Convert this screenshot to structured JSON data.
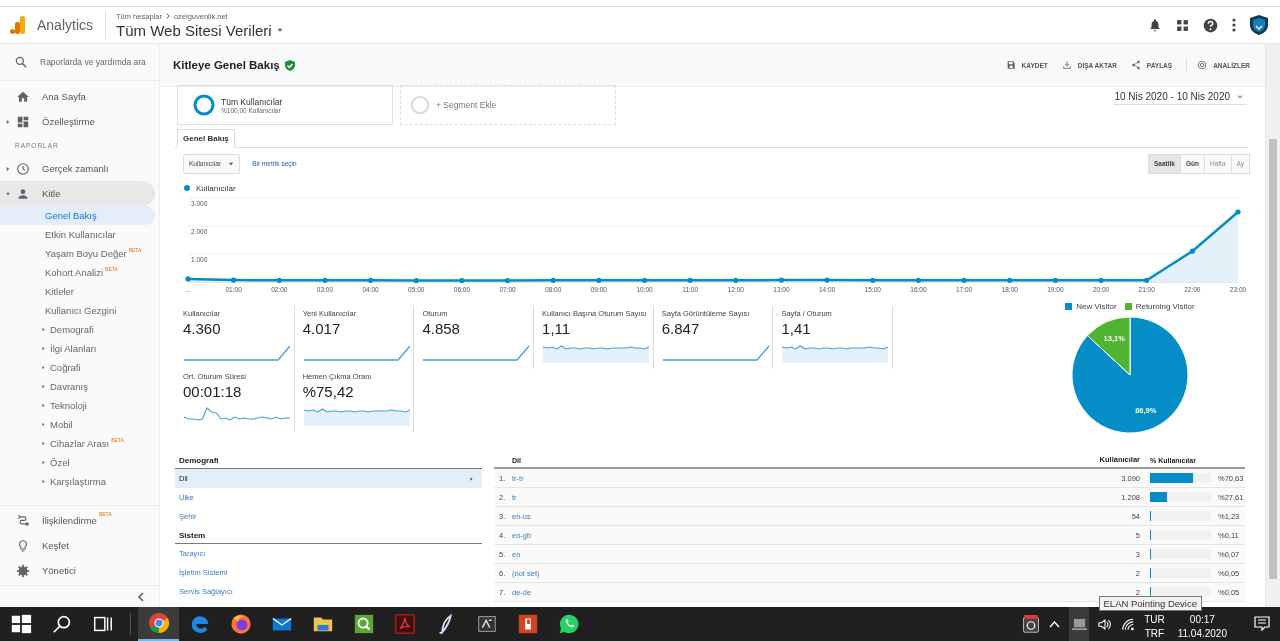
{
  "header": {
    "product": "Analytics",
    "breadcrumb": [
      "Tüm hesaplar",
      "ozelguvenlik.net"
    ],
    "property": "Tüm Web Sitesi Verileri"
  },
  "sidebar": {
    "search_placeholder": "Raporlarda ve yardımda ara",
    "nav": [
      {
        "label": "Ana Sayfa",
        "kind": "home",
        "selected": false
      },
      {
        "label": "Özelleştirme",
        "kind": "dashboard",
        "selected": false,
        "expanded": false
      }
    ],
    "reports_heading": "RAPORLAR",
    "reports": [
      {
        "label": "Gerçek zamanlı",
        "kind": "clock",
        "selected": false,
        "expanded": false
      },
      {
        "label": "Kitle",
        "kind": "person",
        "selected": true,
        "expanded": true,
        "children": [
          {
            "label": "Genel Bakış",
            "selected": true
          },
          {
            "label": "Etkin Kullanıcılar",
            "selected": false
          },
          {
            "label": "Yaşam Boyu Değer",
            "selected": false,
            "badge": "BETA"
          },
          {
            "label": "Kohort Analizi",
            "selected": false,
            "badge": "BETA"
          },
          {
            "label": "Kitleler",
            "selected": false
          },
          {
            "label": "Kullanıcı Gezgini",
            "selected": false
          },
          {
            "label": "Demografi",
            "selected": false,
            "expanded": false
          },
          {
            "label": "İlgi Alanları",
            "selected": false,
            "expanded": false
          },
          {
            "label": "Coğrafi",
            "selected": false,
            "expanded": false
          },
          {
            "label": "Davranış",
            "selected": false,
            "expanded": false
          },
          {
            "label": "Teknoloji",
            "selected": false,
            "expanded": false
          },
          {
            "label": "Mobil",
            "selected": false,
            "expanded": false
          },
          {
            "label": "Cihazlar Arası",
            "selected": false,
            "expanded": false,
            "badge": "BETA"
          },
          {
            "label": "Özel",
            "selected": false,
            "expanded": false
          },
          {
            "label": "Karşılaştırma",
            "selected": false,
            "expanded": false
          }
        ]
      }
    ],
    "bottom": [
      {
        "label": "İlişkilendirme",
        "kind": "attribution",
        "badge": "BETA"
      },
      {
        "label": "Keşfet",
        "kind": "discover"
      },
      {
        "label": "Yönetici",
        "kind": "admin"
      }
    ]
  },
  "report": {
    "title": "Kitleye Genel Bakış",
    "actions": [
      {
        "label": "KAYDET",
        "kind": "save"
      },
      {
        "label": "DIŞA AKTAR",
        "kind": "export"
      },
      {
        "label": "PAYLAŞ",
        "kind": "share"
      },
      {
        "label": "ANALİZLER",
        "kind": "insights"
      }
    ],
    "segments": [
      {
        "kind": "segment",
        "title": "Tüm Kullanıcılar",
        "subtitle": "%100,00 Kullanıcılar"
      },
      {
        "kind": "add",
        "title": "+ Segment Ekle"
      }
    ],
    "date_range": "10 Nis 2020 - 10 Nis 2020",
    "tabs": [
      {
        "label": "Genel Bakış",
        "selected": true
      }
    ],
    "metric_select": {
      "value": "Kullanıcılar",
      "link": "Bir metrik seçin"
    },
    "granularity": [
      {
        "label": "Saatlik",
        "selected": true,
        "disabled": false
      },
      {
        "label": "Gün",
        "selected": false,
        "disabled": false
      },
      {
        "label": "Hafta",
        "selected": false,
        "disabled": true
      },
      {
        "label": "Ay",
        "selected": false,
        "disabled": true
      }
    ],
    "chart_data": {
      "type": "area",
      "categories": [
        "...",
        "01:00",
        "02:00",
        "03:00",
        "04:00",
        "05:00",
        "06:00",
        "07:00",
        "08:00",
        "09:00",
        "10:00",
        "11:00",
        "12:00",
        "13:00",
        "14:00",
        "15:00",
        "16:00",
        "17:00",
        "18:00",
        "19:00",
        "20:00",
        "21:00",
        "22:00",
        "23:00"
      ],
      "series": [
        {
          "name": "Kullanıcılar",
          "color": "#058dc7",
          "values": [
            110,
            70,
            60,
            60,
            60,
            50,
            50,
            50,
            60,
            60,
            60,
            60,
            60,
            70,
            70,
            60,
            60,
            60,
            60,
            60,
            60,
            60,
            1100,
            2500
          ]
        }
      ],
      "ylim": [
        0,
        3000
      ],
      "yticks": [
        {
          "value": 1000,
          "label": "1.000"
        },
        {
          "value": 2000,
          "label": "2.000"
        },
        {
          "value": 3000,
          "label": "3.000"
        }
      ]
    },
    "metrics": [
      {
        "label": "Kullanıcılar",
        "value": "4.360",
        "kind": "rising"
      },
      {
        "label": "Yeni Kullanıcılar",
        "value": "4.017",
        "kind": "rising"
      },
      {
        "label": "Oturum",
        "value": "4.858",
        "kind": "rising"
      },
      {
        "label": "Kullanıcı Başına Oturum Sayısı",
        "value": "1,11",
        "kind": "steady"
      },
      {
        "label": "Sayfa Görüntüleme Sayısı",
        "value": "6.847",
        "kind": "rising"
      },
      {
        "label": "Sayfa / Oturum",
        "value": "1,41",
        "kind": "steady"
      },
      {
        "label": "Ort. Oturum Süresi",
        "value": "00:01:18",
        "kind": "spiky"
      },
      {
        "label": "Hemen Çıkma Oranı",
        "value": "%75,42",
        "kind": "steady"
      }
    ],
    "visitor_chart": {
      "chart_data": {
        "type": "pie",
        "categories": [
          "New Visitor",
          "Returning Visitor"
        ],
        "values": [
          86.9,
          13.1
        ],
        "value_labels": [
          "86,9%",
          "13,1%"
        ]
      }
    },
    "explorer": [
      {
        "title": "Demografi",
        "items": [
          {
            "label": "Dil",
            "selected": true
          },
          {
            "label": "Ülke",
            "selected": false
          },
          {
            "label": "Şehir",
            "selected": false
          }
        ]
      },
      {
        "title": "Sistem",
        "items": [
          {
            "label": "Tarayıcı",
            "selected": false
          },
          {
            "label": "İşletim Sistemi",
            "selected": false
          },
          {
            "label": "Servis Sağlayıcı",
            "selected": false
          }
        ]
      }
    ],
    "table": {
      "columns": [
        "Dil",
        "Kullanıcılar",
        "% Kullanıcılar"
      ],
      "rows": [
        {
          "rank": "1.",
          "name": "tr-tr",
          "users": "3.090",
          "share": "%70,63",
          "level": 0.7063
        },
        {
          "rank": "2.",
          "name": "tr",
          "users": "1.208",
          "share": "%27,61",
          "level": 0.2761
        },
        {
          "rank": "3.",
          "name": "en-us",
          "users": "54",
          "share": "%1,23",
          "level": 0.0123
        },
        {
          "rank": "4.",
          "name": "en-gb",
          "users": "5",
          "share": "%0,11",
          "level": 0.0011
        },
        {
          "rank": "5.",
          "name": "en",
          "users": "3",
          "share": "%0,07",
          "level": 0.0007
        },
        {
          "rank": "6.",
          "name": "(not set)",
          "users": "2",
          "share": "%0,05",
          "level": 0.0005
        },
        {
          "rank": "7.",
          "name": "de-de",
          "users": "2",
          "share": "%0,05",
          "level": 0.0005
        }
      ]
    }
  },
  "taskbar": {
    "items": [
      {
        "kind": "start",
        "selected": false
      },
      {
        "kind": "search",
        "selected": false
      },
      {
        "kind": "taskview",
        "selected": false
      },
      {
        "kind": "chrome",
        "selected": true
      },
      {
        "kind": "edge",
        "selected": false
      },
      {
        "kind": "firefox",
        "selected": false
      },
      {
        "kind": "mail",
        "selected": false
      },
      {
        "kind": "files",
        "selected": false
      },
      {
        "kind": "greenapp",
        "selected": false
      },
      {
        "kind": "acrobat",
        "selected": false
      },
      {
        "kind": "feather",
        "selected": false
      },
      {
        "kind": "darkapp",
        "selected": false
      },
      {
        "kind": "slides",
        "selected": false
      },
      {
        "kind": "chat",
        "selected": false
      }
    ],
    "tooltip": "ELAN Pointing Device",
    "language": "TUR",
    "keyboard": "TRF",
    "time": "00:17",
    "date": "11.04.2020"
  }
}
